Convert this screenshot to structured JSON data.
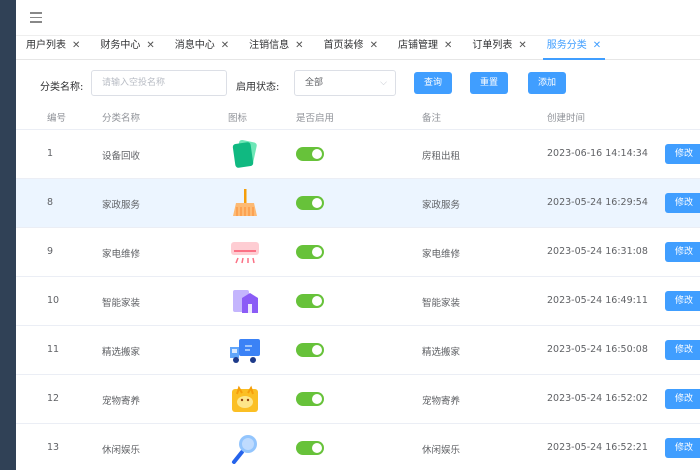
{
  "tabs": [
    {
      "label": "用户列表",
      "active": false
    },
    {
      "label": "财务中心",
      "active": false
    },
    {
      "label": "消息中心",
      "active": false
    },
    {
      "label": "注销信息",
      "active": false
    },
    {
      "label": "首页装修",
      "active": false
    },
    {
      "label": "店铺管理",
      "active": false
    },
    {
      "label": "订单列表",
      "active": false
    },
    {
      "label": "服务分类",
      "active": true
    }
  ],
  "filter": {
    "name_label": "分类名称:",
    "name_placeholder": "请输入空投名称",
    "status_label": "启用状态:",
    "status_value": "全部",
    "query_label": "查询",
    "reset_label": "重置",
    "add_label": "添加"
  },
  "table": {
    "headers": {
      "id": "编号",
      "name": "分类名称",
      "icon": "图标",
      "enabled": "是否启用",
      "remark": "备注",
      "created": "创建时间"
    },
    "rows": [
      {
        "id": "1",
        "name": "设备回收",
        "icon": "green-cards-icon",
        "enabled": true,
        "remark": "房租出租",
        "created": "2023-06-16 14:14:34",
        "edit": "修改"
      },
      {
        "id": "8",
        "name": "家政服务",
        "icon": "broom-icon",
        "enabled": true,
        "remark": "家政服务",
        "created": "2023-05-24 16:29:54",
        "edit": "修改"
      },
      {
        "id": "9",
        "name": "家电维修",
        "icon": "air-conditioner-icon",
        "enabled": true,
        "remark": "家电维修",
        "created": "2023-05-24 16:31:08",
        "edit": "修改"
      },
      {
        "id": "10",
        "name": "智能家装",
        "icon": "smart-home-icon",
        "enabled": true,
        "remark": "智能家装",
        "created": "2023-05-24 16:49:11",
        "edit": "修改"
      },
      {
        "id": "11",
        "name": "精选搬家",
        "icon": "moving-truck-icon",
        "enabled": true,
        "remark": "精选搬家",
        "created": "2023-05-24 16:50:08",
        "edit": "修改"
      },
      {
        "id": "12",
        "name": "宠物寄养",
        "icon": "pet-icon",
        "enabled": true,
        "remark": "宠物寄养",
        "created": "2023-05-24 16:52:02",
        "edit": "修改"
      },
      {
        "id": "13",
        "name": "休闲娱乐",
        "icon": "badminton-icon",
        "enabled": true,
        "remark": "休闲娱乐",
        "created": "2023-05-24 16:52:21",
        "edit": "修改"
      }
    ]
  },
  "colors": {
    "primary": "#409eff",
    "switch_on": "#67c23a",
    "sidebar": "#304156",
    "row_highlight": "#ecf5ff"
  }
}
